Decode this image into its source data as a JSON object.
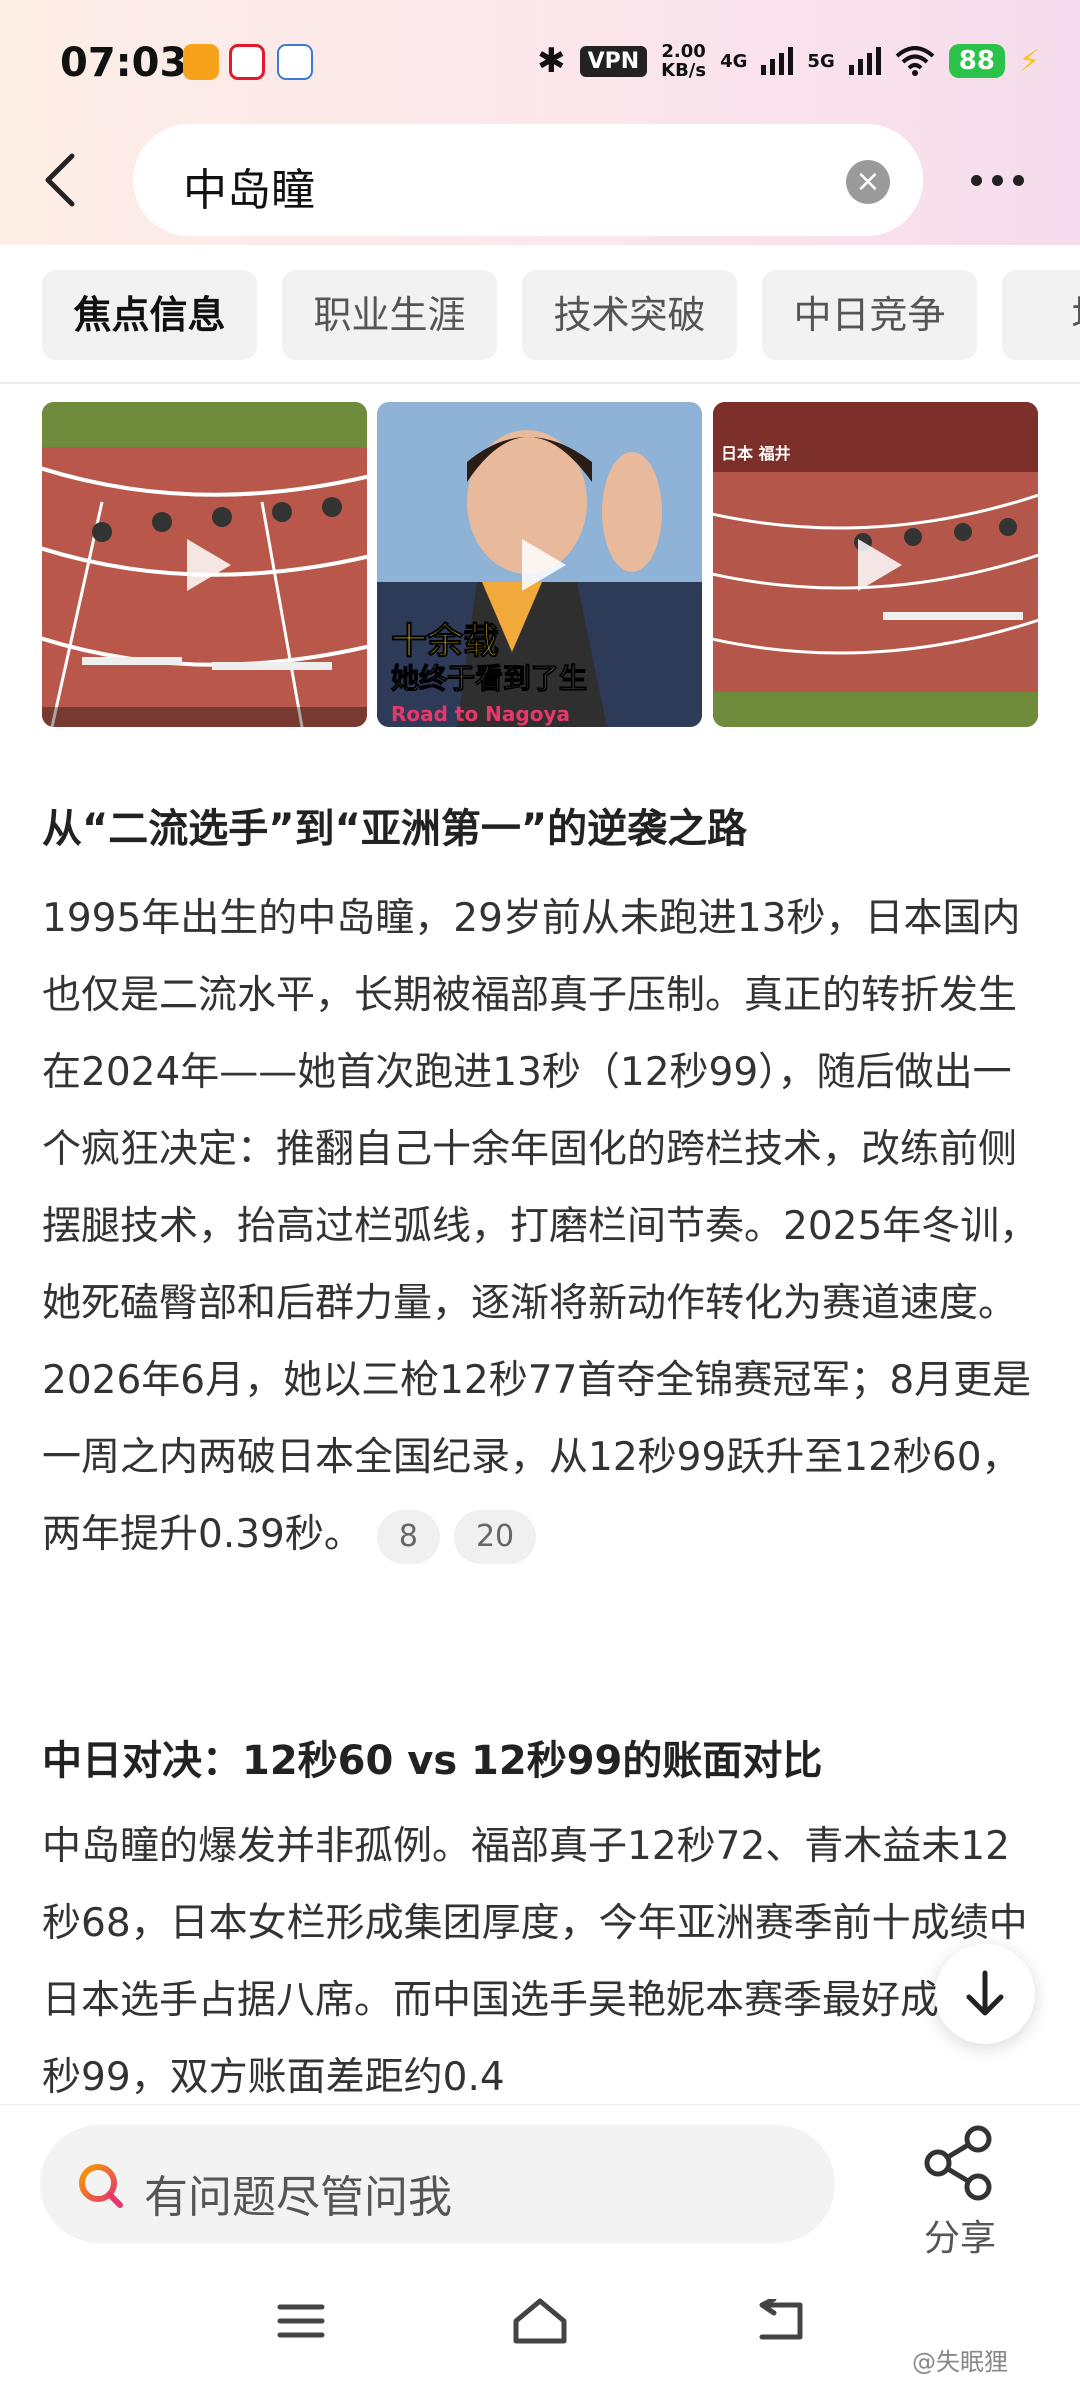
{
  "status_bar": {
    "time": "07:03",
    "vpn": "VPN",
    "speed_value": "2.00",
    "speed_unit": "KB/s",
    "net1": "4G",
    "net2": "5G",
    "battery": "88"
  },
  "search": {
    "query": "中岛瞳"
  },
  "tabs": [
    "焦点信息",
    "职业生涯",
    "技术突破",
    "中日竞争",
    "场外"
  ],
  "videos": [
    {
      "caption": ""
    },
    {
      "caption_line1": "十余载",
      "caption_line2": "她终于看到了生",
      "caption_line3": "Road to Nagoya"
    },
    {
      "caption": "日本 福井"
    }
  ],
  "sections": [
    {
      "title": "从“二流选手”到“亚洲第一”的逆袭之路",
      "body": "1995年出生的中岛瞳，29岁前从未跑进13秒，日本国内也仅是二流水平，长期被福部真子压制。真正的转折发生在2024年——她首次跑进13秒（12秒99），随后做出一个疯狂决定：推翻自己十余年固化的跨栏技术，改练前侧摆腿技术，抬高过栏弧线，打磨栏间节奏。2025年冬训，她死磕臀部和后群力量，逐渐将新动作转化为赛道速度。2026年6月，她以三枪12秒77首夺全锦赛冠军；8月更是一周之内两破日本全国纪录，从12秒99跃升至12秒60，两年提升0.39秒。",
      "citations": [
        "8",
        "20"
      ]
    },
    {
      "title": "中日对决：12秒60 vs 12秒99的账面对比",
      "body": "中岛瞳的爆发并非孤例。福部真子12秒72、青木益未12秒68，日本女栏形成集团厚度，今年亚洲赛季前十成绩中日本选手占据八席。而中国选手吴艳妮本赛季最好成绩12秒99，双方账面差距约0.4"
    }
  ],
  "ask": {
    "placeholder": "有问题尽管问我"
  },
  "share": {
    "label": "分享"
  },
  "watermark": "@失眠狸",
  "colors": {
    "accent": "#e8376b",
    "battery": "#2bc24a"
  }
}
